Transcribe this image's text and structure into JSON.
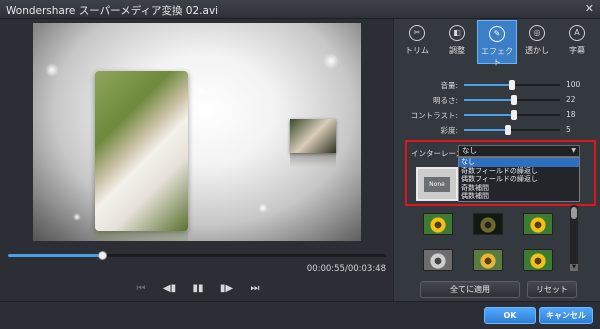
{
  "window": {
    "title": "Wondershare スーパーメディア変換 02.avi",
    "close_glyph": "✕"
  },
  "player": {
    "progress": 0.248,
    "time_display": "00:00:55/00:03:48",
    "controls": [
      {
        "name": "skip-back-icon",
        "glyph": "⏮",
        "enabled": false
      },
      {
        "name": "step-back-icon",
        "glyph": "◀▮",
        "enabled": true
      },
      {
        "name": "pause-icon",
        "glyph": "▮▮",
        "enabled": true
      },
      {
        "name": "step-forward-icon",
        "glyph": "▮▶",
        "enabled": true
      },
      {
        "name": "skip-forward-icon",
        "glyph": "⏭",
        "enabled": true
      }
    ]
  },
  "tabs": [
    {
      "label": "トリム",
      "icon": "scissors-icon",
      "glyph": "✂",
      "active": false
    },
    {
      "label": "調整",
      "icon": "crop-icon",
      "glyph": "◧",
      "active": false
    },
    {
      "label": "エフェクト",
      "icon": "effect-icon",
      "glyph": "✎",
      "active": true
    },
    {
      "label": "透かし",
      "icon": "watermark-icon",
      "glyph": "◎",
      "active": false
    },
    {
      "label": "字幕",
      "icon": "subtitle-icon",
      "glyph": "A",
      "active": false
    }
  ],
  "adjustments": [
    {
      "label": "音量:",
      "value": "100",
      "level": 0.5
    },
    {
      "label": "明るさ:",
      "value": "22",
      "level": 0.52
    },
    {
      "label": "コントラスト:",
      "value": "18",
      "level": 0.52
    },
    {
      "label": "彩度:",
      "value": "5",
      "level": 0.46
    }
  ],
  "interlace": {
    "label": "インターレース:",
    "selected": "なし",
    "options": [
      "なし",
      "奇数フィールドの繰返し",
      "偶数フィールドの繰返し",
      "奇数補間",
      "偶数補間"
    ]
  },
  "effect_preview": {
    "label": "None"
  },
  "buttons": {
    "apply_all": "全てに適用",
    "reset": "リセット",
    "ok": "OK",
    "cancel": "キャンセル"
  },
  "colors": {
    "accent": "#3a7fc8",
    "highlight": "#e0161c",
    "ok_button": "#2f7fd3"
  }
}
